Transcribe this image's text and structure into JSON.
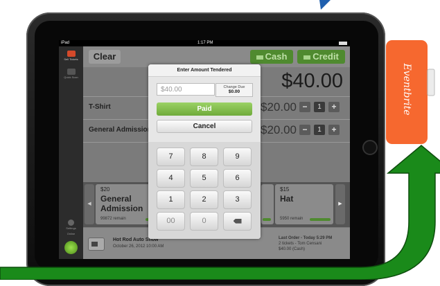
{
  "status_bar": {
    "device": "iPad",
    "time": "1:17 PM"
  },
  "rail": {
    "sell_label": "Sell Tickets",
    "quick_label": "Quick Scan",
    "settings_label": "Settings",
    "online_label": "Online"
  },
  "topbar": {
    "clear": "Clear",
    "cash": "Cash",
    "credit": "Credit"
  },
  "total": "$40.00",
  "line_items": [
    {
      "label": "T-Shirt",
      "price": "$20.00",
      "qty": "1"
    },
    {
      "label": "General Admission",
      "price": "$20.00",
      "qty": "1"
    }
  ],
  "tray": {
    "cards": [
      {
        "price": "$20",
        "name": "General Admission",
        "remain": "99872 remain"
      },
      {
        "price": "$15",
        "name": "Hat",
        "remain": "5950 remain"
      }
    ]
  },
  "event": {
    "title": "Hot Rod Auto Show",
    "date": "October 26, 2012 10:00 AM"
  },
  "last_order": {
    "line1": "Last Order - Today 5:29 PM",
    "line2": "2 tickets - Tom Censani",
    "line3": "$40.00 (Cash)"
  },
  "popup": {
    "title": "Enter Amount Tendered",
    "placeholder": "$40.00",
    "change_label": "Change Due",
    "change_value": "$0.00",
    "paid": "Paid",
    "cancel": "Cancel",
    "keys": [
      "7",
      "8",
      "9",
      "4",
      "5",
      "6",
      "1",
      "2",
      "3",
      "00",
      "0"
    ]
  },
  "eventbrite_logo": "Eventbrite",
  "colors": {
    "accent_green": "#6faa3a",
    "arrow_green": "#1a8a1a",
    "eventbrite_orange": "#f6682f"
  }
}
